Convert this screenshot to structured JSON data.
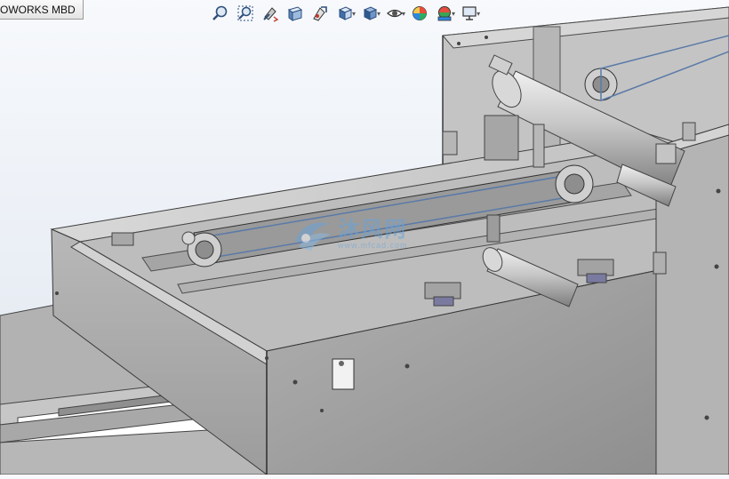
{
  "tab": {
    "label": "OWORKS MBD"
  },
  "toolbar": {
    "items": [
      {
        "icon": "zoom-to-fit-icon",
        "has_dropdown": false
      },
      {
        "icon": "zoom-to-area-icon",
        "has_dropdown": false
      },
      {
        "icon": "previous-view-icon",
        "has_dropdown": false
      },
      {
        "icon": "section-view-icon",
        "has_dropdown": false
      },
      {
        "icon": "dynamic-annotation-views-icon",
        "has_dropdown": false
      },
      {
        "icon": "view-orientation-icon",
        "has_dropdown": true
      },
      {
        "icon": "display-style-icon",
        "has_dropdown": true
      },
      {
        "icon": "hide-show-items-icon",
        "has_dropdown": true
      },
      {
        "icon": "edit-appearance-icon",
        "has_dropdown": false
      },
      {
        "icon": "apply-scene-icon",
        "has_dropdown": true
      },
      {
        "icon": "view-settings-icon",
        "has_dropdown": true
      }
    ]
  },
  "watermark": {
    "text": "沐风网",
    "url": "www.mfcad.com"
  },
  "colors": {
    "metal_light": "#c9c9c9",
    "metal_mid": "#a9a9a9",
    "metal_dark": "#7f7f7f",
    "background_top": "#f7f9fc",
    "background_bottom": "#dde4ee"
  }
}
